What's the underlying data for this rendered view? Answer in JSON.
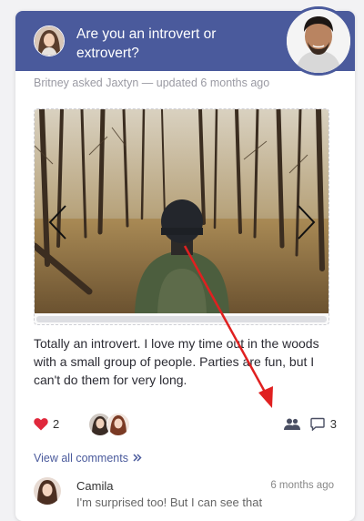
{
  "question": {
    "title": "Are you an introvert or extrovert?",
    "meta": "Britney asked Jaxtyn — updated 6 months ago"
  },
  "answer": {
    "text": "Totally an introvert.  I love my time out in the woods with a small group of people. Parties are fun, but I can't do them for very long."
  },
  "actions": {
    "like_count": "2",
    "comment_count": "3",
    "like_icon": "heart-icon",
    "people_icon": "people-icon",
    "comment_icon": "comment-icon"
  },
  "comments": {
    "view_all_label": "View all comments",
    "view_all_icon": "double-chevron-right-icon",
    "items": [
      {
        "name": "Camila",
        "time": "6 months ago",
        "text": "I'm surprised too! But I can see that"
      }
    ]
  },
  "colors": {
    "header": "#4a5a9c",
    "like": "#e0283c",
    "link": "#4a5a9c",
    "annotation": "#e02020"
  }
}
